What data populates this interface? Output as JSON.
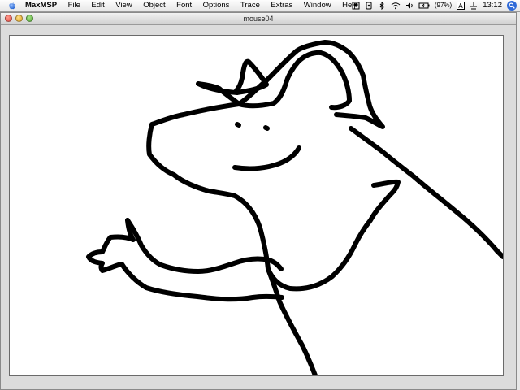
{
  "menubar": {
    "apple_icon": "apple-logo-icon",
    "items": [
      {
        "label": "MaxMSP",
        "app": true
      },
      {
        "label": "File"
      },
      {
        "label": "Edit"
      },
      {
        "label": "View"
      },
      {
        "label": "Object"
      },
      {
        "label": "Font"
      },
      {
        "label": "Options"
      },
      {
        "label": "Trace"
      },
      {
        "label": "Extras"
      },
      {
        "label": "Window"
      },
      {
        "label": "Help"
      }
    ],
    "battery_percent": "(97%)",
    "clock": "13:12"
  },
  "window": {
    "title": "mouse04"
  },
  "drawing": {
    "stroke_color": "#000000",
    "background_color": "#ffffff"
  }
}
